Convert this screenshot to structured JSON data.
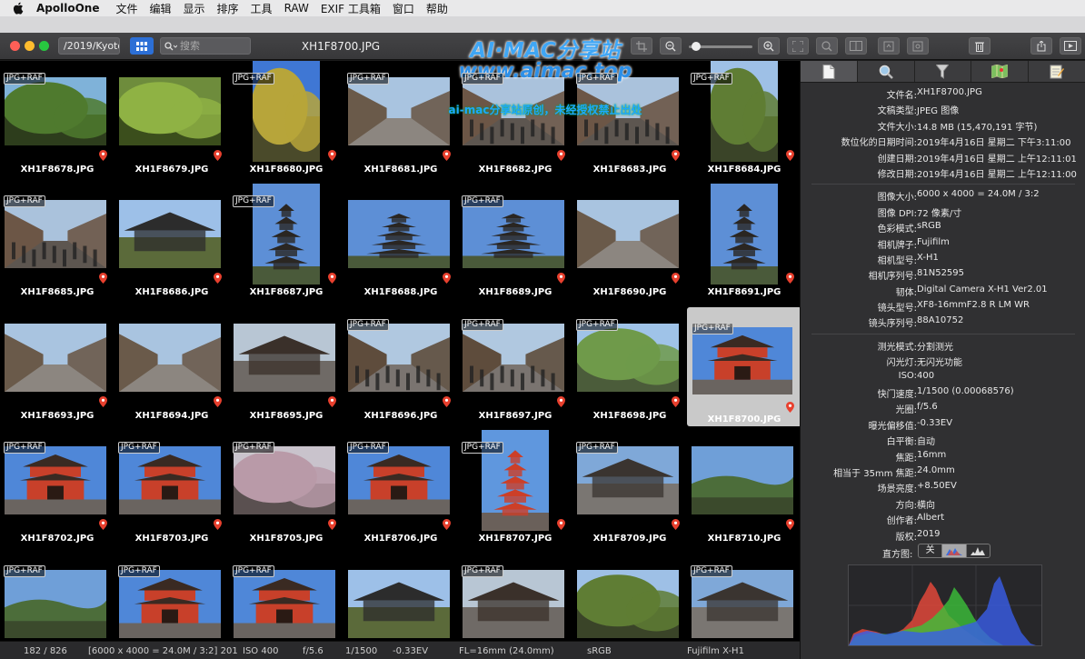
{
  "menubar": {
    "app_name": "ApolloOne",
    "items": [
      "文件",
      "编辑",
      "显示",
      "排序",
      "工具",
      "RAW",
      "EXIF 工具箱",
      "窗口",
      "帮助"
    ]
  },
  "toolbar": {
    "path_label": "/2019/Kyoto",
    "search_placeholder": "搜索",
    "window_title": "XH1F8700.JPG",
    "zoom_value": 0.05
  },
  "watermark": {
    "line1": "AI·MAC分享站",
    "line2": "www.aimac.top",
    "line3": "ai-mac分享站原创，未经授权禁止出处"
  },
  "badge_label": "JPG+RAF",
  "grid": {
    "rows": [
      [
        {
          "name": "XH1F8678.JPG",
          "badge": true,
          "pin": true,
          "scene": "tree",
          "orient": "l"
        },
        {
          "name": "XH1F8679.JPG",
          "badge": false,
          "pin": true,
          "scene": "leaves",
          "orient": "l"
        },
        {
          "name": "XH1F8680.JPG",
          "badge": true,
          "pin": true,
          "scene": "yellowtree",
          "orient": "p"
        },
        {
          "name": "XH1F8681.JPG",
          "badge": true,
          "pin": true,
          "scene": "street",
          "orient": "l"
        },
        {
          "name": "XH1F8682.JPG",
          "badge": true,
          "pin": true,
          "scene": "crowd",
          "orient": "l"
        },
        {
          "name": "XH1F8683.JPG",
          "badge": true,
          "pin": true,
          "scene": "crowd",
          "orient": "l"
        },
        {
          "name": "XH1F8684.JPG",
          "badge": true,
          "pin": true,
          "scene": "garden",
          "orient": "p"
        }
      ],
      [
        {
          "name": "XH1F8685.JPG",
          "badge": true,
          "pin": true,
          "scene": "crowd",
          "orient": "l"
        },
        {
          "name": "XH1F8686.JPG",
          "badge": false,
          "pin": true,
          "scene": "roof",
          "orient": "l"
        },
        {
          "name": "XH1F8687.JPG",
          "badge": true,
          "pin": true,
          "scene": "pagoda",
          "orient": "p"
        },
        {
          "name": "XH1F8688.JPG",
          "badge": false,
          "pin": true,
          "scene": "pagoda",
          "orient": "l"
        },
        {
          "name": "XH1F8689.JPG",
          "badge": true,
          "pin": true,
          "scene": "pagoda",
          "orient": "l"
        },
        {
          "name": "XH1F8690.JPG",
          "badge": false,
          "pin": true,
          "scene": "street",
          "orient": "l"
        },
        {
          "name": "XH1F8691.JPG",
          "badge": false,
          "pin": true,
          "scene": "pagoda",
          "orient": "p"
        }
      ],
      [
        {
          "name": "XH1F8693.JPG",
          "badge": false,
          "pin": true,
          "scene": "street",
          "orient": "l"
        },
        {
          "name": "XH1F8694.JPG",
          "badge": false,
          "pin": true,
          "scene": "street",
          "orient": "l"
        },
        {
          "name": "XH1F8695.JPG",
          "badge": false,
          "pin": true,
          "scene": "gate",
          "orient": "l"
        },
        {
          "name": "XH1F8696.JPG",
          "badge": true,
          "pin": true,
          "scene": "stairs",
          "orient": "l"
        },
        {
          "name": "XH1F8697.JPG",
          "badge": true,
          "pin": true,
          "scene": "stairs",
          "orient": "l"
        },
        {
          "name": "XH1F8698.JPG",
          "badge": true,
          "pin": true,
          "scene": "willow",
          "orient": "l"
        },
        {
          "name": "XH1F8700.JPG",
          "badge": true,
          "pin": true,
          "scene": "redgate",
          "orient": "l",
          "selected": true
        }
      ],
      [
        {
          "name": "XH1F8702.JPG",
          "badge": true,
          "pin": true,
          "scene": "redgate",
          "orient": "l"
        },
        {
          "name": "XH1F8703.JPG",
          "badge": true,
          "pin": true,
          "scene": "redgate",
          "orient": "l"
        },
        {
          "name": "XH1F8705.JPG",
          "badge": true,
          "pin": true,
          "scene": "blossom",
          "orient": "l"
        },
        {
          "name": "XH1F8706.JPG",
          "badge": true,
          "pin": true,
          "scene": "redgate",
          "orient": "l"
        },
        {
          "name": "XH1F8707.JPG",
          "badge": true,
          "pin": true,
          "scene": "redpagoda",
          "orient": "p"
        },
        {
          "name": "XH1F8709.JPG",
          "badge": true,
          "pin": true,
          "scene": "temple",
          "orient": "l"
        },
        {
          "name": "XH1F8710.JPG",
          "badge": false,
          "pin": true,
          "scene": "landscape",
          "orient": "l"
        }
      ],
      [
        {
          "name": "",
          "badge": true,
          "pin": false,
          "scene": "landscape",
          "orient": "l"
        },
        {
          "name": "",
          "badge": true,
          "pin": false,
          "scene": "redgate",
          "orient": "l"
        },
        {
          "name": "",
          "badge": true,
          "pin": false,
          "scene": "redgate",
          "orient": "l"
        },
        {
          "name": "",
          "badge": false,
          "pin": false,
          "scene": "roof",
          "orient": "l"
        },
        {
          "name": "",
          "badge": true,
          "pin": false,
          "scene": "gate",
          "orient": "l"
        },
        {
          "name": "",
          "badge": false,
          "pin": false,
          "scene": "garden",
          "orient": "l"
        },
        {
          "name": "",
          "badge": true,
          "pin": false,
          "scene": "temple",
          "orient": "l"
        }
      ]
    ]
  },
  "statusbar": {
    "count": "182 / 826",
    "size": "[6000 x 4000 = 24.0M / 3:2] 201",
    "iso": "ISO 400",
    "aperture": "f/5.6",
    "shutter": "1/1500",
    "ev": "-0.33EV",
    "fl": "FL=16mm (24.0mm)",
    "colorspace": "sRGB",
    "camera": "Fujifilm X-H1"
  },
  "inspector": {
    "groups": [
      [
        {
          "k": "文件名:",
          "v": "XH1F8700.JPG"
        },
        {
          "k": "文稿类型:",
          "v": "JPEG 图像"
        },
        {
          "k": "文件大小:",
          "v": "14.8 MB (15,470,191 字节)"
        },
        {
          "k": "数位化的日期时间:",
          "v": "2019年4月16日 星期二 下午3:11:00"
        },
        {
          "k": "创建日期:",
          "v": "2019年4月16日 星期二 上午12:11:01"
        },
        {
          "k": "修改日期:",
          "v": "2019年4月16日 星期二 上午12:11:00"
        }
      ],
      [
        {
          "k": "图像大小:",
          "v": "6000 x 4000 = 24.0M / 3:2"
        },
        {
          "k": "图像 DPI:",
          "v": "72 像素/寸"
        },
        {
          "k": "色彩模式:",
          "v": "sRGB"
        },
        {
          "k": "相机牌子:",
          "v": "Fujifilm"
        },
        {
          "k": "相机型号:",
          "v": "X-H1"
        },
        {
          "k": "相机序列号:",
          "v": "81N52595"
        },
        {
          "k": "韧体:",
          "v": "Digital Camera X-H1 Ver2.01"
        },
        {
          "k": "镜头型号:",
          "v": "XF8-16mmF2.8 R LM WR"
        },
        {
          "k": "镜头序列号:",
          "v": "88A10752"
        }
      ],
      [
        {
          "k": "测光模式:",
          "v": "分割测光"
        },
        {
          "k": "闪光灯:",
          "v": "无闪光功能"
        },
        {
          "k": "ISO:",
          "v": "400"
        },
        {
          "k": "快门速度:",
          "v": "1/1500 (0.00068576)"
        },
        {
          "k": "光圈:",
          "v": "f/5.6"
        },
        {
          "k": "曝光偏移值:",
          "v": "-0.33EV"
        },
        {
          "k": "白平衡:",
          "v": "自动"
        },
        {
          "k": "焦距:",
          "v": "16mm"
        },
        {
          "k": "相当于 35mm 焦距:",
          "v": "24.0mm"
        },
        {
          "k": "场景亮度:",
          "v": "+8.50EV"
        },
        {
          "k": "方向:",
          "v": "横向"
        },
        {
          "k": "创作者:",
          "v": "Albert"
        },
        {
          "k": "版权:",
          "v": "2019"
        }
      ]
    ],
    "histogram_label": "直方图:",
    "histogram_off": "关"
  }
}
